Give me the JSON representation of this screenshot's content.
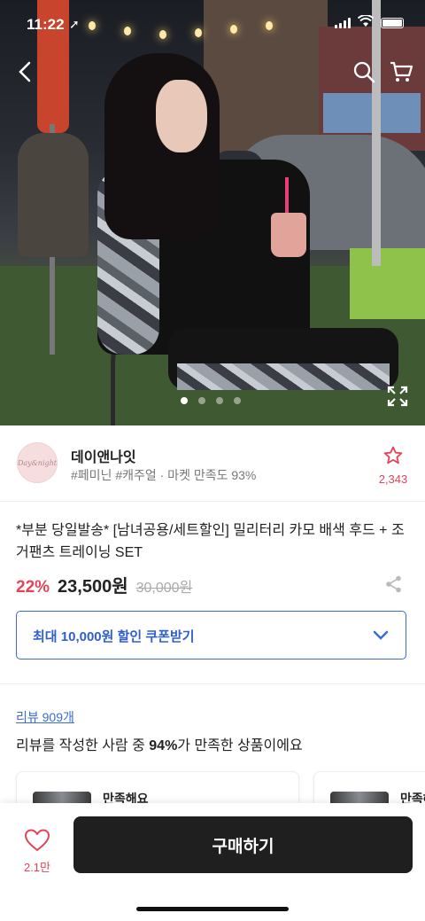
{
  "status_bar": {
    "time": "11:22",
    "location_arrow": "➚"
  },
  "hero": {
    "page_count": 4,
    "active_page": 1
  },
  "seller": {
    "name": "데이앤나잇",
    "meta": "#페미닌 #캐주얼 · 마켓 만족도 93%",
    "logo_text": "Day&night",
    "favorite_count": "2,343"
  },
  "product": {
    "title": "*부분 당일발송* [남녀공용/세트할인] 밀리터리 카모 배색 후드 + 조거팬츠 트레이닝 SET",
    "discount_rate": "22%",
    "price": "23,500원",
    "original_price": "30,000원"
  },
  "coupon": {
    "label": "최대 10,000원 할인 쿠폰받기"
  },
  "review": {
    "link": "리뷰 909개",
    "summary_prefix": "리뷰를 작성한 사람 중 ",
    "summary_percent": "94%",
    "summary_suffix": "가 만족한 상품이에요",
    "cards": [
      {
        "label": "만족해요"
      },
      {
        "label": "만족해요"
      }
    ]
  },
  "bottom_bar": {
    "like_count": "2.1만",
    "buy_label": "구매하기"
  },
  "colors": {
    "accent_red": "#e5435a",
    "accent_blue": "#3b6bd6",
    "buy_button": "#1f1f1f"
  },
  "icons": [
    "back-arrow-icon",
    "search-icon",
    "cart-icon",
    "expand-icon",
    "star-icon",
    "share-icon",
    "chevron-down-icon",
    "heart-icon"
  ]
}
